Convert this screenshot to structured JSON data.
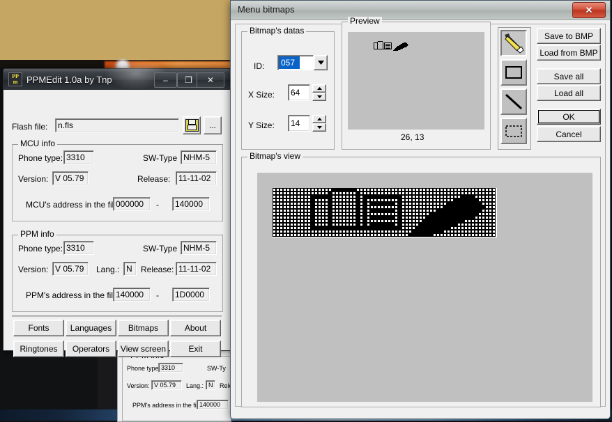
{
  "desktop": {
    "name": "windows-desktop"
  },
  "ppmedit": {
    "title": "PPMEdit 1.0a by Tnp",
    "icon": "ppm-app-icon",
    "icon_top": "PP",
    "icon_bottom": "m",
    "titlebar_buttons": {
      "minimize": "–",
      "maximize": "❐",
      "close": "✕"
    },
    "flash_label": "Flash file:",
    "flash_value": "n.fls",
    "save_icon": "floppy-disk-icon",
    "browse_label": "...",
    "mcu": {
      "legend": "MCU info",
      "phone_type_label": "Phone type:",
      "phone_type_value": "3310",
      "sw_type_label": "SW-Type",
      "sw_type_value": "NHM-5",
      "version_label": "Version:",
      "version_value": "V 05.79",
      "release_label": "Release:",
      "release_value": "11-11-02",
      "address_label": "MCU's address in the file:",
      "address_start": "000000",
      "address_sep": "-",
      "address_end": "140000"
    },
    "ppm": {
      "legend": "PPM info",
      "phone_type_label": "Phone type:",
      "phone_type_value": "3310",
      "sw_type_label": "SW-Type",
      "sw_type_value": "NHM-5",
      "version_label": "Version:",
      "version_value": "V 05.79",
      "lang_label": "Lang.:",
      "lang_value": "N",
      "release_label": "Release:",
      "release_value": "11-11-02",
      "address_label": "PPM's address in the file:",
      "address_start": "140000",
      "address_sep": "-",
      "address_end": "1D0000"
    },
    "buttons": [
      "Fonts",
      "Languages",
      "Bitmaps",
      "About",
      "Ringtones",
      "Operators",
      "View screen",
      "Exit"
    ]
  },
  "dialog": {
    "title": "Menu bitmaps",
    "close_label": "✕",
    "bitmap_datas": {
      "legend": "Bitmap's datas",
      "id_label": "ID:",
      "id_value": "057",
      "id_dropdown_icon": "chevron-down-icon",
      "xsize_label": "X Size:",
      "xsize_value": "64",
      "ysize_label": "Y Size:",
      "ysize_value": "14",
      "spinner_up_icon": "spinner-up-icon",
      "spinner_down_icon": "spinner-down-icon"
    },
    "preview": {
      "legend": "Preview",
      "coords": "26, 13"
    },
    "tools": [
      {
        "name": "pencil-tool",
        "icon": "pencil-icon",
        "selected": true
      },
      {
        "name": "rectangle-tool",
        "icon": "rectangle-icon",
        "selected": false
      },
      {
        "name": "line-tool",
        "icon": "line-icon",
        "selected": false
      },
      {
        "name": "select-tool",
        "icon": "dashed-rectangle-icon",
        "selected": false
      }
    ],
    "side_buttons": [
      "Save to BMP",
      "Load from BMP",
      "Save all",
      "Load all",
      "OK",
      "Cancel"
    ],
    "bitmap_view": {
      "legend": "Bitmap's view"
    }
  },
  "bitmap": {
    "width": 64,
    "height": 14,
    "rows": [
      "0000000000000000011111110000000000000000000000000000000000000000",
      "0000000000000000100000001000000000000000000000000000000000000000",
      "0000000000011111100000001011111111111000000000000000001111000000",
      "0000000000010000100000001010000000001000000000000000111111100000",
      "0000000000010000100000001010111111101000000000000011111111110000",
      "0000000000010000100000001010000000001000000000000111111111111000",
      "0000000000010000100000001010111111101000000000011111111111110000",
      "0000000000010000100000001010000000001000000001111111111111100000",
      "0000000000010000100000001010111111101000000011111111111111000000",
      "0000000000010000100000001010000000001000000111111111111000000000",
      "0000000000010000100000001010111111101000001111111111100000000000",
      "0000000000011111111111111111111111111000011111111110000000000000",
      "0000000000000000000000000000000000000000111111111000000000000000",
      "0000000000000000000000000000000000000001111111000000000000000000"
    ]
  },
  "background_window": {
    "legend": "PPM info",
    "phone_type_label": "Phone type:",
    "phone_type_value": "3310",
    "sw_type_label": "SW-Ty",
    "version_label": "Version:",
    "version_value": "V 05.79",
    "lang_label": "Lang.:",
    "lang_value": "N",
    "release_label": "Release",
    "address_label": "PPM's address in the file:",
    "address_start": "140000"
  },
  "colors": {
    "dialog_face": "#f0f0f0",
    "win95_face": "#efefef",
    "canvas_gray": "#c0c0c0",
    "selection_blue": "#0a64c8",
    "desktop_tan": "#c6a663",
    "close_red": "#d2513a"
  }
}
